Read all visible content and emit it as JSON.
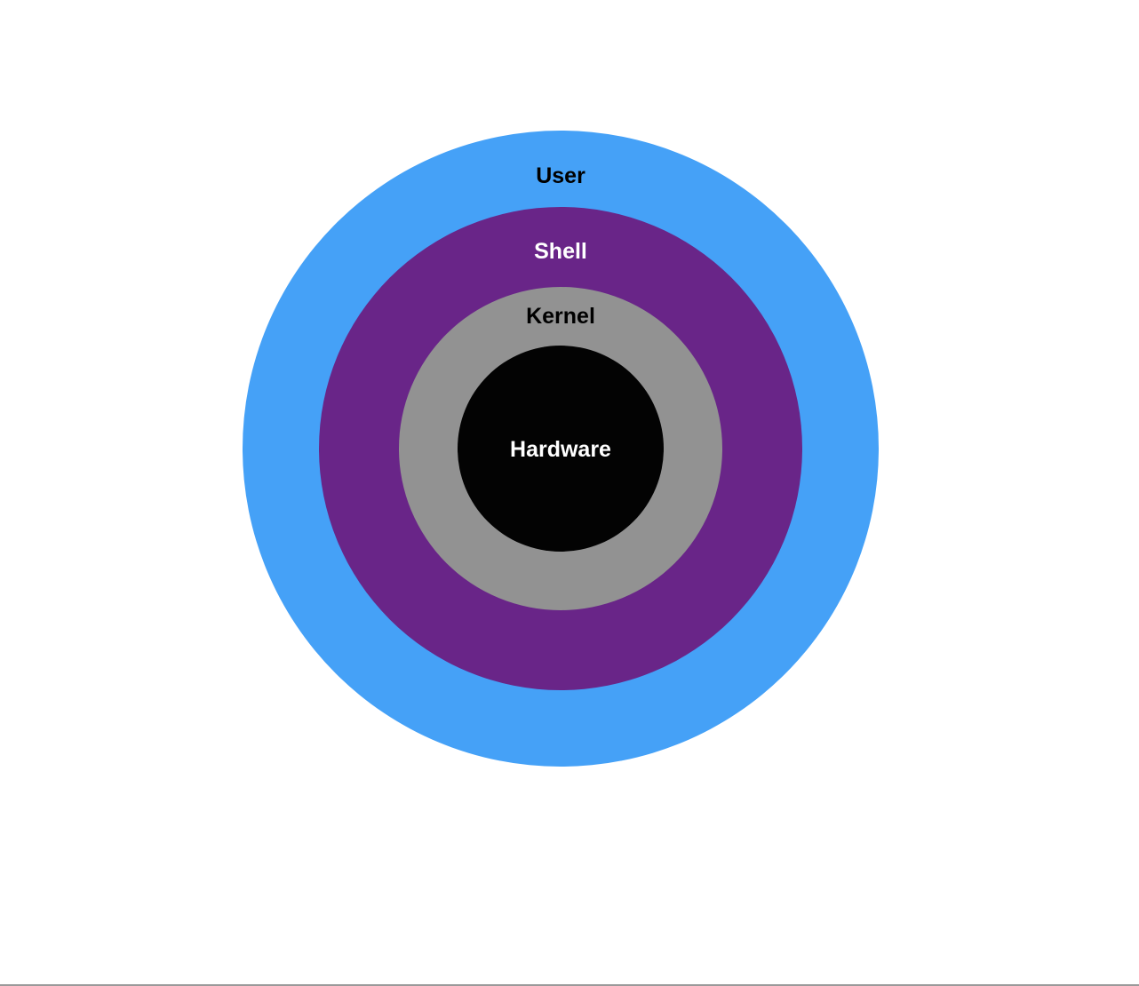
{
  "layers": [
    {
      "id": "user",
      "label": "User",
      "fill": "#45a1f7",
      "text_color": "#000000"
    },
    {
      "id": "shell",
      "label": "Shell",
      "fill": "#692588",
      "text_color": "#ffffff"
    },
    {
      "id": "kernel",
      "label": "Kernel",
      "fill": "#929292",
      "text_color": "#000000"
    },
    {
      "id": "hardware",
      "label": "Hardware",
      "fill": "#030303",
      "text_color": "#ffffff"
    }
  ]
}
